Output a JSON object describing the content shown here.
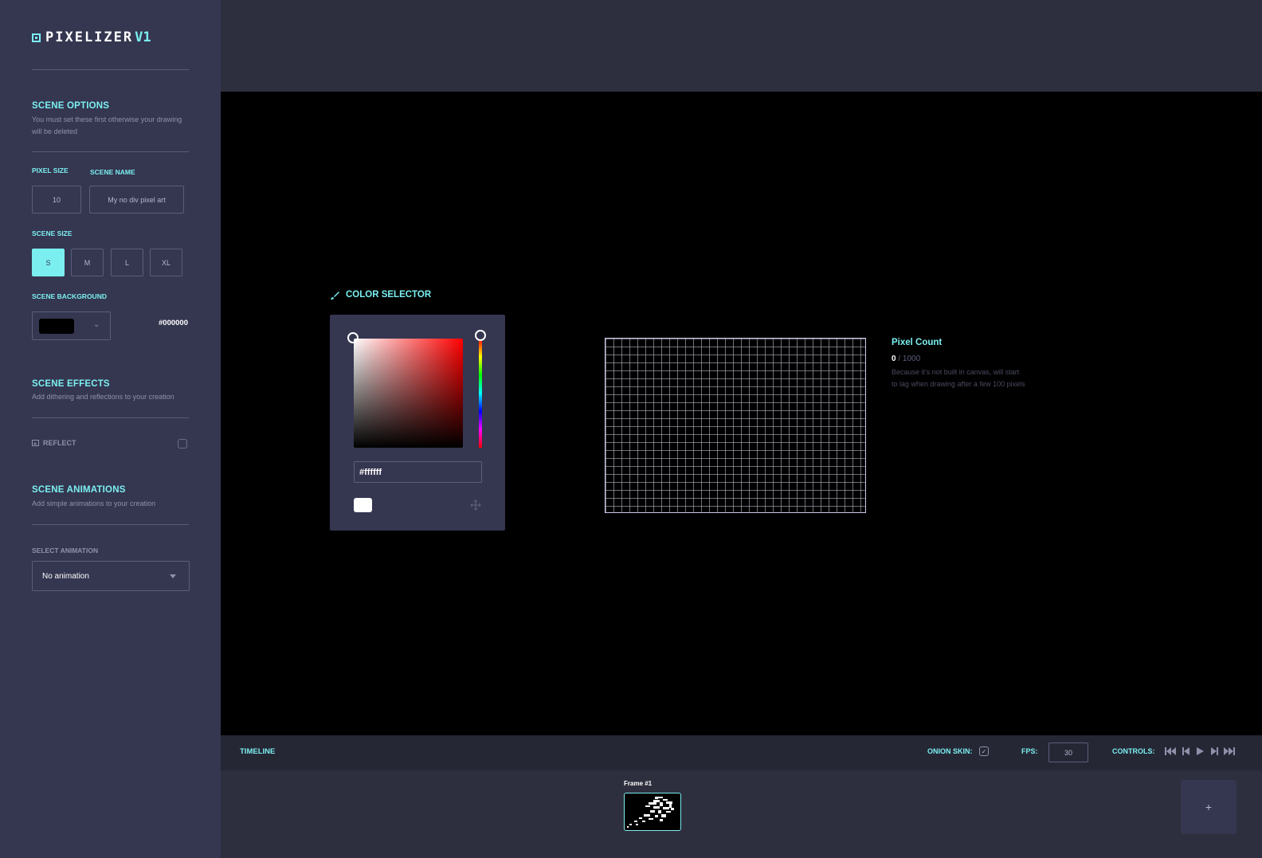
{
  "app": {
    "logo_text": "PIXELIZER",
    "logo_version": "V1"
  },
  "sidebar": {
    "scene_options": {
      "title": "SCENE OPTIONS",
      "description": "You must set these first otherwise your drawing will be deleted"
    },
    "pixel_size": {
      "label": "PIXEL SIZE",
      "value": "10"
    },
    "scene_name": {
      "label": "SCENE NAME",
      "value": "My no div pixel art"
    },
    "scene_size": {
      "label": "SCENE SIZE",
      "options": [
        "S",
        "M",
        "L",
        "XL"
      ],
      "selected": "S"
    },
    "scene_background": {
      "label": "SCENE BACKGROUND",
      "value": "#000000"
    },
    "scene_effects": {
      "title": "SCENE EFFECTS",
      "description": "Add dithering and reflections to your creation",
      "reflect_label": "REFLECT",
      "reflect_checked": false
    },
    "scene_animations": {
      "title": "SCENE ANIMATIONS",
      "description": "Add simple animations to your creation",
      "select_label": "SELECT ANIMATION",
      "selected": "No animation"
    }
  },
  "color_selector": {
    "title": "COLOR SELECTOR",
    "hex_value": "#ffffff",
    "current_color": "#ffffff",
    "hue_color": "#ff0000"
  },
  "pixel_count": {
    "title": "Pixel Count",
    "current": "0",
    "separator": " / ",
    "max": "1000",
    "note": "Because it's not built in canvas, will start to lag when drawing after a few 100 pixels"
  },
  "timeline": {
    "title": "TIMELINE",
    "onion_skin_label": "ONION SKIN:",
    "onion_skin_checked": true,
    "fps_label": "FPS:",
    "fps_value": "30",
    "controls_label": "CONTROLS:",
    "controls": [
      "first-frame-icon",
      "prev-frame-icon",
      "play-icon",
      "next-frame-icon",
      "last-frame-icon"
    ]
  },
  "frames": {
    "items": [
      {
        "label": "Frame #1"
      }
    ],
    "add_label": "+"
  },
  "colors": {
    "accent": "#7beff0",
    "sidebar_bg": "#353650",
    "topbar_bg": "#2e2f3e",
    "timeline_bg": "#262735",
    "stage_bg": "#000000"
  }
}
